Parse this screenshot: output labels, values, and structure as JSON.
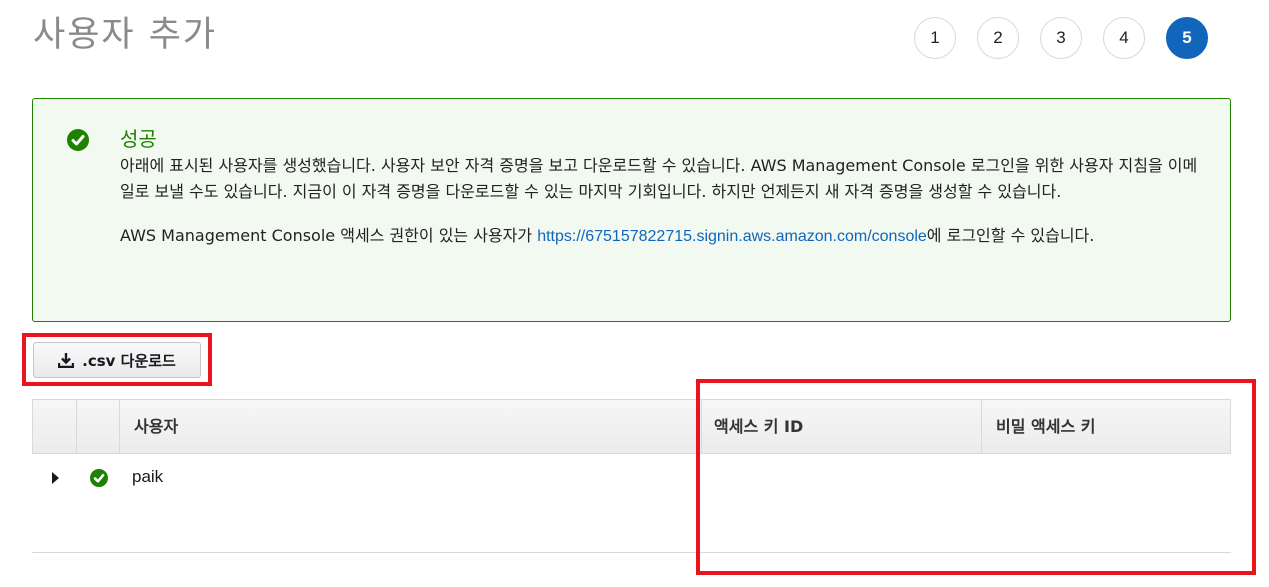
{
  "page": {
    "title": "사용자 추가"
  },
  "steps": [
    "1",
    "2",
    "3",
    "4",
    "5"
  ],
  "active_step": "5",
  "alert": {
    "title": "성공",
    "message": "아래에 표시된 사용자를 생성했습니다. 사용자 보안 자격 증명을 보고 다운로드할 수 있습니다. AWS Management Console 로그인을 위한 사용자 지침을 이메일로 보낼 수도 있습니다. 지금이 이 자격 증명을 다운로드할 수 있는 마지막 기회입니다. 하지만 언제든지 새 자격 증명을 생성할 수 있습니다.",
    "console_prefix": "AWS Management Console 액세스 권한이 있는 사용자가 ",
    "console_link": "https://675157822715.signin.aws.amazon.com/console",
    "console_suffix": "에 로그인할 수 있습니다."
  },
  "csv_button": {
    "label": ".csv 다운로드",
    "icon": "download-icon"
  },
  "table": {
    "headers": {
      "user": "사용자",
      "access_key_id": "액세스 키 ID",
      "secret_access_key": "비밀 액세스 키"
    },
    "rows": [
      {
        "user": "paik",
        "status_icon": "check-circle-icon"
      }
    ]
  },
  "colors": {
    "success": "#1d8102",
    "accent": "#1166bb",
    "highlight": "#e8141e"
  }
}
